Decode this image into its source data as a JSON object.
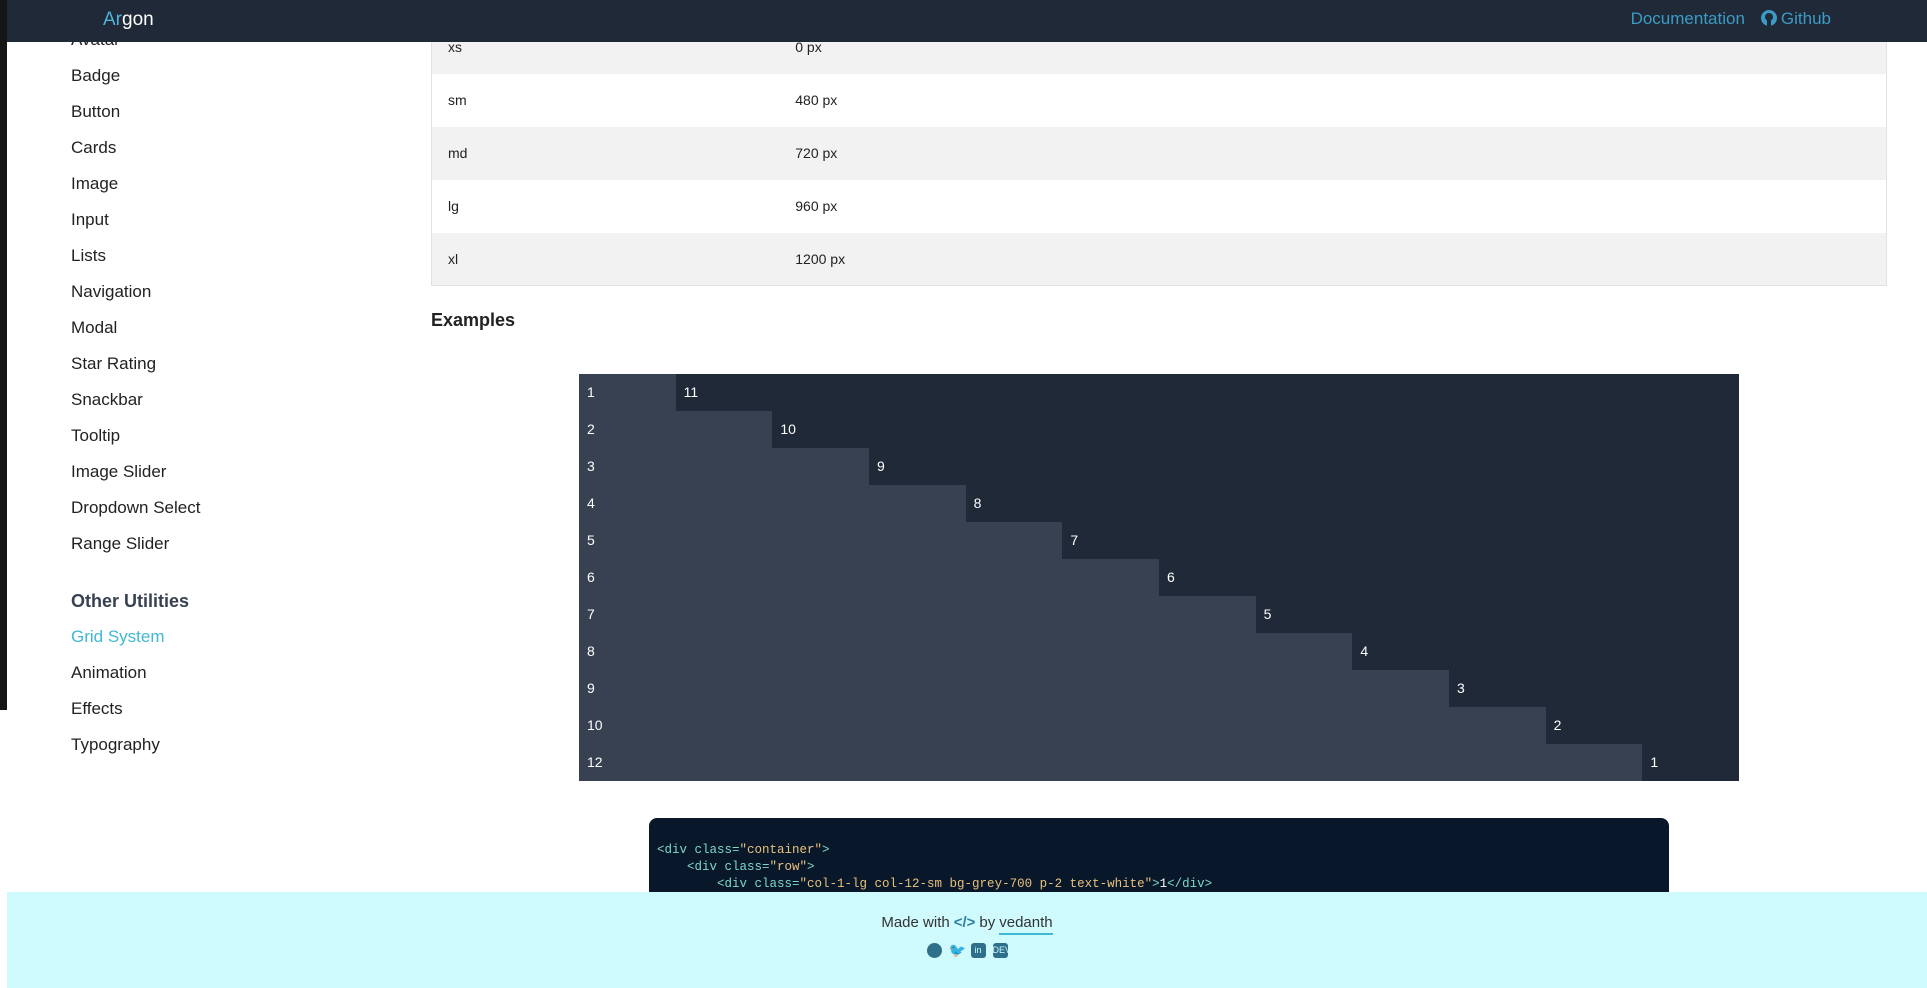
{
  "header": {
    "logo_accent": "Ar",
    "logo_rest": "gon",
    "nav": [
      "Documentation",
      "Github"
    ]
  },
  "sidebar": {
    "items": [
      "Avatar",
      "Badge",
      "Button",
      "Cards",
      "Image",
      "Input",
      "Lists",
      "Navigation",
      "Modal",
      "Star Rating",
      "Snackbar",
      "Tooltip",
      "Image Slider",
      "Dropdown Select",
      "Range Slider"
    ],
    "section": "Other Utilities",
    "utilities": [
      "Grid System",
      "Animation",
      "Effects",
      "Typography"
    ],
    "active": "Grid System"
  },
  "breakpoints": [
    [
      "xs",
      "0 px"
    ],
    [
      "sm",
      "480 px"
    ],
    [
      "md",
      "720 px"
    ],
    [
      "lg",
      "960 px"
    ],
    [
      "xl",
      "1200 px"
    ]
  ],
  "examples_title": "Examples",
  "grid_rows": [
    [
      "1",
      "11"
    ],
    [
      "2",
      "10"
    ],
    [
      "3",
      "9"
    ],
    [
      "4",
      "8"
    ],
    [
      "5",
      "7"
    ],
    [
      "6",
      "6"
    ],
    [
      "7",
      "5"
    ],
    [
      "8",
      "4"
    ],
    [
      "9",
      "3"
    ],
    [
      "10",
      "2"
    ],
    [
      "12",
      "1"
    ]
  ],
  "code": {
    "l1a": "<div class=",
    "l1b": "\"container\"",
    "l1c": ">",
    "l2a": "    <div class=",
    "l2b": "\"row\"",
    "l2c": ">",
    "l3a": "        <div class=",
    "l3b": "\"col-1-lg col-12-sm bg-grey-700 p-2 text-white\"",
    "l3c": ">",
    "l3d": "1",
    "l3e": "</div>"
  },
  "footer": {
    "made": "Made with",
    "icon": "</>",
    "by": "by",
    "author": "vedanth",
    "social": [
      "github",
      "twitter",
      "linkedin",
      "dev"
    ]
  },
  "colors": {
    "header": "#1f2937",
    "accent": "#3fb8d6",
    "footer": "#cffafe"
  }
}
